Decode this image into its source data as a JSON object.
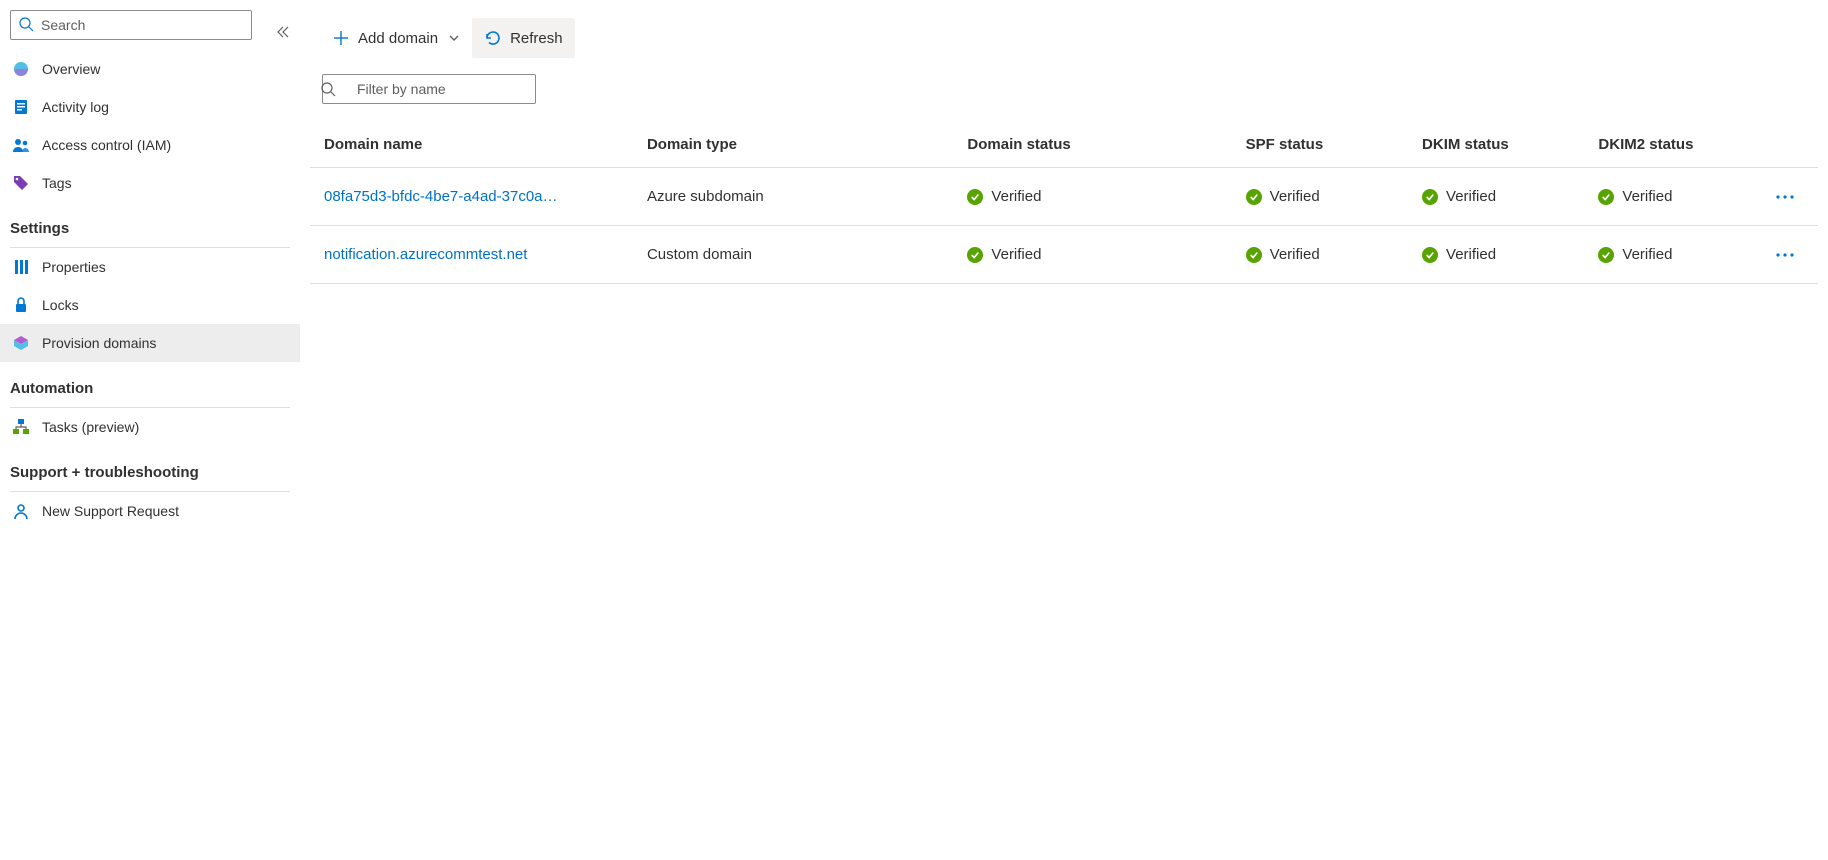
{
  "sidebar": {
    "search_placeholder": "Search",
    "nav": {
      "overview": "Overview",
      "activity_log": "Activity log",
      "access_control": "Access control (IAM)",
      "tags": "Tags"
    },
    "sections": {
      "settings": {
        "title": "Settings",
        "properties": "Properties",
        "locks": "Locks",
        "provision_domains": "Provision domains"
      },
      "automation": {
        "title": "Automation",
        "tasks": "Tasks (preview)"
      },
      "support": {
        "title": "Support + troubleshooting",
        "new_support": "New Support Request"
      }
    }
  },
  "toolbar": {
    "add_domain": "Add domain",
    "refresh": "Refresh"
  },
  "filter": {
    "placeholder": "Filter by name"
  },
  "table": {
    "headers": {
      "domain_name": "Domain name",
      "domain_type": "Domain type",
      "domain_status": "Domain status",
      "spf_status": "SPF status",
      "dkim_status": "DKIM status",
      "dkim2_status": "DKIM2 status"
    },
    "rows": [
      {
        "domain_name": "08fa75d3-bfdc-4be7-a4ad-37c0a…",
        "domain_type": "Azure subdomain",
        "domain_status": "Verified",
        "spf_status": "Verified",
        "dkim_status": "Verified",
        "dkim2_status": "Verified"
      },
      {
        "domain_name": "notification.azurecommtest.net",
        "domain_type": "Custom domain",
        "domain_status": "Verified",
        "spf_status": "Verified",
        "dkim_status": "Verified",
        "dkim2_status": "Verified"
      }
    ]
  }
}
